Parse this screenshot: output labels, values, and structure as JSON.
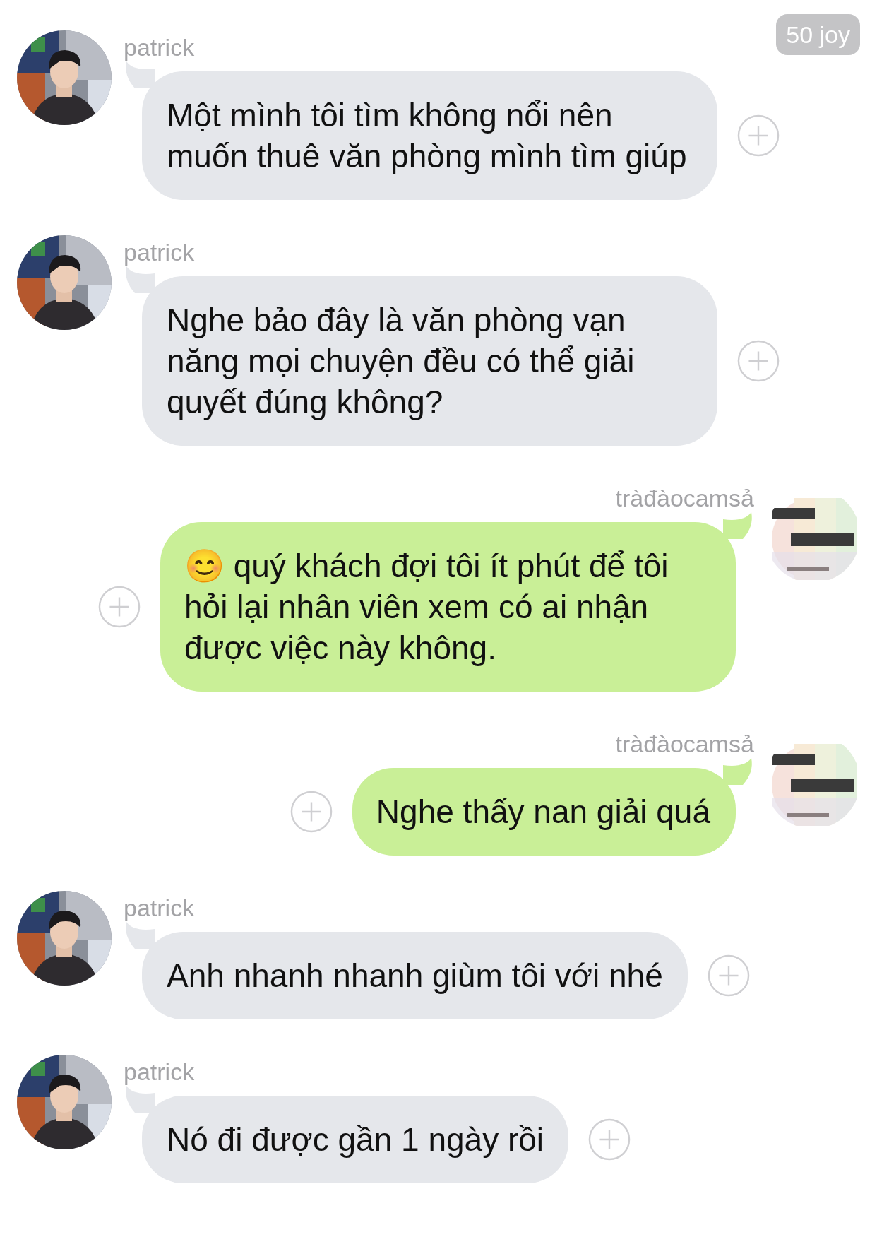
{
  "badge": "50 joy",
  "messages": [
    {
      "kind": "incoming",
      "sender": "patrick",
      "text": "Một mình tôi tìm không nổi nên muốn thuê văn phòng mình tìm giúp"
    },
    {
      "kind": "incoming",
      "sender": "patrick",
      "text": "Nghe bảo đây là văn phòng vạn năng mọi chuyện đều có thể giải quyết đúng không?"
    },
    {
      "kind": "outgoing",
      "sender": "tràđàocamsả",
      "text": "😊 quý khách đợi tôi ít phút để tôi hỏi lại nhân viên xem có ai nhận được việc này không."
    },
    {
      "kind": "outgoing",
      "sender": "tràđàocamsả",
      "text": "Nghe thấy nan giải quá"
    },
    {
      "kind": "incoming",
      "sender": "patrick",
      "text": "Anh nhanh nhanh giùm tôi với nhé"
    },
    {
      "kind": "incoming",
      "sender": "patrick",
      "text": "Nó đi được gần 1 ngày rồi"
    }
  ]
}
